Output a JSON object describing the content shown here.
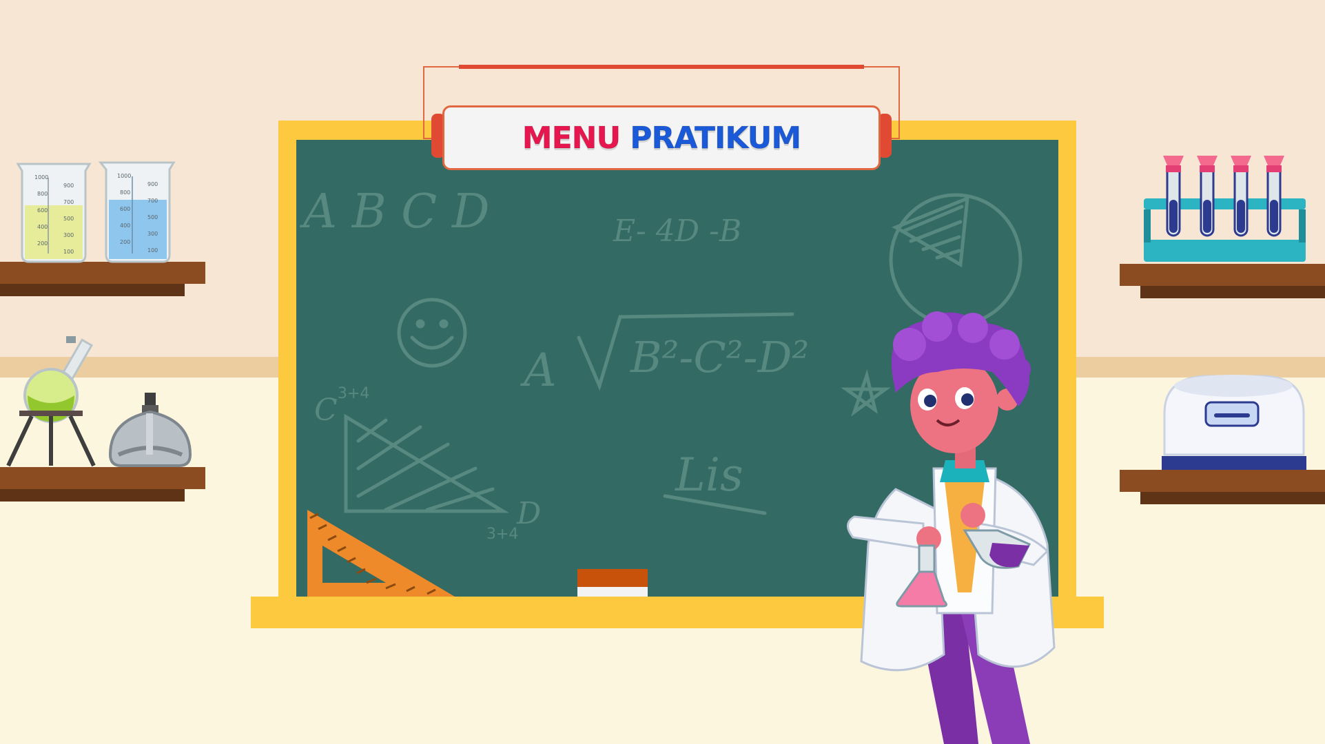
{
  "title": {
    "word1": "MENU",
    "word2": "PRATIKUM",
    "word1_color": "#e8164e",
    "word2_color": "#1a5ad8"
  },
  "chalkboard": {
    "letters": "A B C D",
    "eq1": "E- 4D -B",
    "eq2_prefix": "A",
    "eq2_radicand": "B²-C²-D²",
    "tri_top": "C",
    "tri_top_sup": "3+4",
    "tri_right": "D",
    "tri_bottom": "3+4",
    "word": "Lis"
  },
  "beakers": [
    {
      "ticks": [
        "1000",
        "800",
        "600",
        "400",
        "200"
      ],
      "ticks_right": [
        "900",
        "700",
        "500",
        "300",
        "100"
      ],
      "liquid": "#e6ec9a"
    },
    {
      "ticks": [
        "1000",
        "800",
        "600",
        "400",
        "200"
      ],
      "ticks_right": [
        "900",
        "700",
        "500",
        "300",
        "100"
      ],
      "liquid": "#8fc6ee"
    }
  ],
  "colors": {
    "wall": "#f6e6d3",
    "floor": "#fdf6df",
    "board": "#336a63",
    "frame": "#fdc93f",
    "shelf": "#8c4c22"
  }
}
